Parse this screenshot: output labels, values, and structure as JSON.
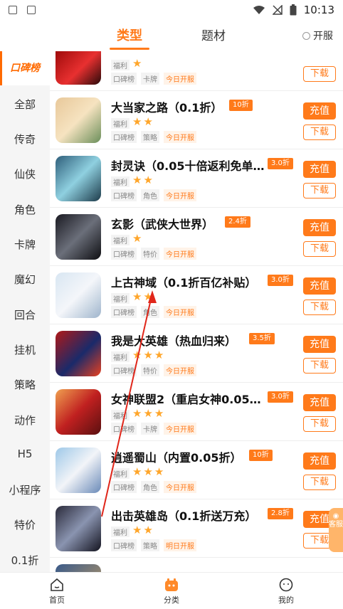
{
  "status": {
    "time": "10:13"
  },
  "tabs": [
    {
      "label": "类型"
    },
    {
      "label": "题材"
    }
  ],
  "open_toggle": "开服",
  "sidebar": [
    {
      "label": "口碑榜"
    },
    {
      "label": "全部"
    },
    {
      "label": "传奇"
    },
    {
      "label": "仙侠"
    },
    {
      "label": "角色"
    },
    {
      "label": "卡牌"
    },
    {
      "label": "魔幻"
    },
    {
      "label": "回合"
    },
    {
      "label": "挂机"
    },
    {
      "label": "策略"
    },
    {
      "label": "动作"
    },
    {
      "label": "H5"
    },
    {
      "label": "小程序"
    },
    {
      "label": "特价"
    },
    {
      "label": "0.1折"
    }
  ],
  "buttons": {
    "charge": "充值",
    "download": "下载"
  },
  "games": [
    {
      "name": "",
      "discount": "",
      "fuli": "福利",
      "stars": "★",
      "tags": [
        "口碑榜",
        "卡牌",
        "今日开服"
      ]
    },
    {
      "name": "大当家之路（0.1折）",
      "discount": "10折",
      "fuli": "福利",
      "stars": "★★",
      "tags": [
        "口碑榜",
        "策略",
        "今日开服"
      ]
    },
    {
      "name": "封灵诀（0.05十倍返利免单…",
      "discount": "3.0折",
      "fuli": "福利",
      "stars": "★★",
      "tags": [
        "口碑榜",
        "角色",
        "今日开服"
      ]
    },
    {
      "name": "玄影（武侠大世界）",
      "discount": "2.4折",
      "fuli": "福利",
      "stars": "★",
      "tags": [
        "口碑榜",
        "特价",
        "今日开服"
      ]
    },
    {
      "name": "上古神域（0.1折百亿补贴）",
      "discount": "3.0折",
      "fuli": "福利",
      "stars": "★★",
      "tags": [
        "口碑榜",
        "角色",
        "今日开服"
      ]
    },
    {
      "name": "我是大英雄（热血归来）",
      "discount": "3.5折",
      "fuli": "福利",
      "stars": "★★★",
      "tags": [
        "口碑榜",
        "特价",
        "今日开服"
      ]
    },
    {
      "name": "女神联盟2（重启女神0.05…",
      "discount": "3.0折",
      "fuli": "福利",
      "stars": "★★★",
      "tags": [
        "口碑榜",
        "卡牌",
        "今日开服"
      ]
    },
    {
      "name": "逍遥蜀山（内置0.05折）",
      "discount": "10折",
      "fuli": "福利",
      "stars": "★★★",
      "tags": [
        "口碑榜",
        "角色",
        "今日开服"
      ]
    },
    {
      "name": "出击英雄岛（0.1折送万充）",
      "discount": "2.8折",
      "fuli": "福利",
      "stars": "★★",
      "tags": [
        "口碑榜",
        "策略",
        "明日开服"
      ]
    }
  ],
  "cs_label": "客服",
  "bottom_nav": [
    {
      "label": "首页"
    },
    {
      "label": "分类"
    },
    {
      "label": "我的"
    }
  ],
  "colors": {
    "accent": "#ff7a1a",
    "annotation": "#e0261a"
  }
}
